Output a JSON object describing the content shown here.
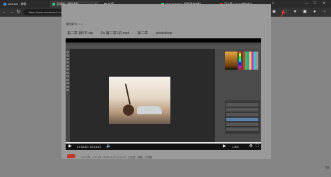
{
  "tabs": [
    {
      "label": "yubinker - 博客",
      "active": false,
      "favicon_color": "#4a90d9"
    },
    {
      "label": "云课堂 - 视频课程",
      "active": true,
      "favicon_color": "#2ecc71"
    },
    {
      "label": "扩展",
      "active": false,
      "favicon_color": "#888888"
    },
    {
      "label": "Global Speed: 视频速度控制",
      "active": false,
      "favicon_color": "#2ecc71"
    },
    {
      "label": "写文章-CSDN创作中心",
      "active": false,
      "favicon_color": "#c0392b"
    }
  ],
  "new_tab": "+",
  "window": {
    "minimize": "—",
    "maximize": "☐",
    "close": "✕"
  },
  "address": {
    "url": "https://www.mosoteach.cn/web/index.php?c=res&m=video&clazz_course_id=7E9A0250-5B45-45C7-A228-9E4E8A5A5A5A"
  },
  "page": {
    "breadcrumb": "课程章节 / / / /",
    "video_title": [
      "第二章 第5节.zip",
      "Ps 第二章1讲.mp4",
      "第二章",
      "photoshop"
    ],
    "os_legend": "",
    "meta": "3.07 MB · 4.17 MB · 2022-11-07 11:14:52 · 已完成 · 观看 · 已观看"
  },
  "player": {
    "time": "01:18:43 / 01:18:43",
    "speed": "1.00x",
    "progress": 1.0
  },
  "colors": {
    "accent": "#e53935"
  }
}
